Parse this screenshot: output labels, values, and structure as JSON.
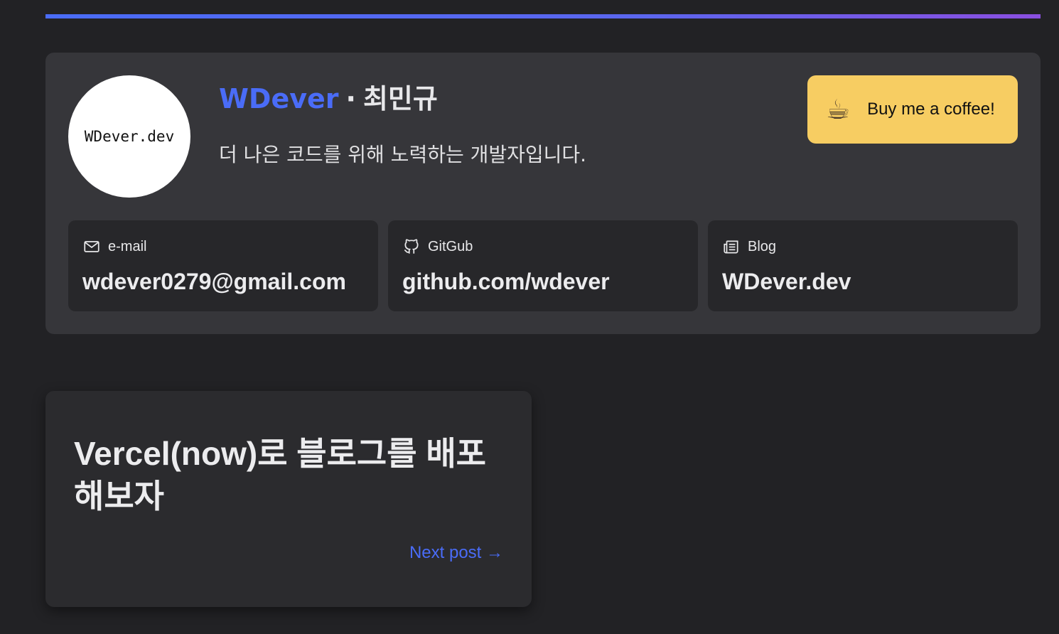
{
  "profile": {
    "avatar_text": "WDever.dev",
    "handle": "WDever",
    "separator": "·",
    "real_name": "최민규",
    "bio": "더 나은 코드를 위해 노력하는 개발자입니다.",
    "coffee_icon": "☕",
    "coffee_label": "Buy me a coffee!"
  },
  "contacts": [
    {
      "icon": "mail-icon",
      "kind": "e-mail",
      "value": "wdever0279@gmail.com"
    },
    {
      "icon": "github-icon",
      "kind": "GitGub",
      "value": "github.com/wdever"
    },
    {
      "icon": "newspaper-icon",
      "kind": "Blog",
      "value": "WDever.dev"
    }
  ],
  "next_post": {
    "title": "Vercel(now)로 블로그를 배포해보자",
    "link_label": "Next post →"
  },
  "colors": {
    "accent": "#4a6cf7",
    "coffee_bg": "#f7cd62",
    "card_bg": "#36363a",
    "page_bg": "#222225"
  }
}
